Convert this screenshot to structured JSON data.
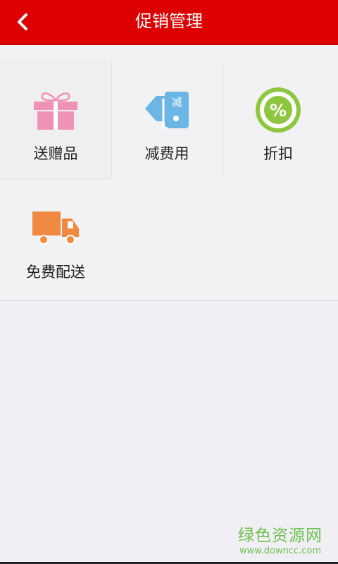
{
  "header": {
    "title": "促销管理",
    "back_icon": "chevron-left-icon",
    "background_color": "#dd0000"
  },
  "tiles": [
    {
      "label": "送赠品",
      "icon": "gift-icon",
      "color": "#ef93b6"
    },
    {
      "label": "减费用",
      "icon": "discount-tag-icon",
      "color": "#6cb6e6",
      "tag_text": "减"
    },
    {
      "label": "折扣",
      "icon": "percent-badge-icon",
      "color": "#8dc63f",
      "symbol": "%"
    },
    {
      "label": "免费配送",
      "icon": "delivery-truck-icon",
      "color": "#f08a43"
    }
  ],
  "watermark": {
    "title": "绿色资源网",
    "url": "www.downcc.com",
    "color": "#6fc04f"
  }
}
